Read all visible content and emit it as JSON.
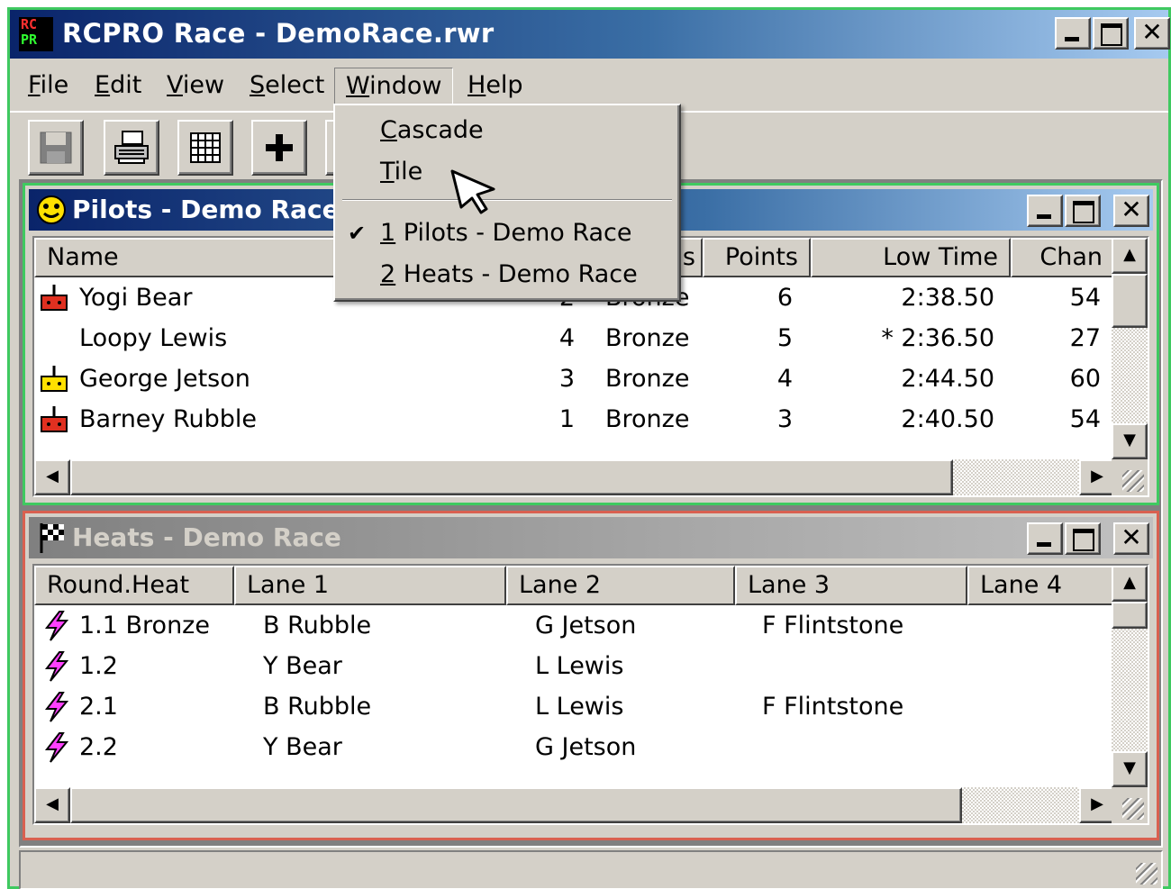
{
  "app": {
    "title": "RCPRO Race - DemoRace.rwr",
    "icon_text_top": "RC",
    "icon_text_bottom": "PR",
    "frame_color": "#3fc960"
  },
  "menubar": {
    "items": [
      {
        "key": "F",
        "rest": "ile"
      },
      {
        "key": "E",
        "rest": "dit"
      },
      {
        "key": "V",
        "rest": "iew"
      },
      {
        "key": "S",
        "rest": "elect"
      },
      {
        "key": "W",
        "rest": "indow"
      },
      {
        "key": "H",
        "rest": "elp"
      }
    ]
  },
  "toolbar": {
    "buttons": [
      "save-icon",
      "print-icon",
      "grid-icon",
      "add-icon"
    ]
  },
  "window_menu": {
    "cascade": {
      "key": "C",
      "rest": "ascade"
    },
    "tile": {
      "key": "T",
      "rest": "ile"
    },
    "windows": [
      {
        "key": "1",
        "rest": " Pilots - Demo Race",
        "checked": true
      },
      {
        "key": "2",
        "rest": " Heats - Demo Race",
        "checked": false
      }
    ]
  },
  "pilots_window": {
    "title": "Pilots - Demo Race",
    "border_color": "#3fc960",
    "columns": [
      "Name",
      "",
      "",
      "Points",
      "Low Time",
      "Chan"
    ],
    "hidden_header_fragment": "s",
    "rows": [
      {
        "name": "Yogi Bear",
        "num": "2",
        "class": "Bronze",
        "points": "6",
        "low_time": "2:38.50",
        "chan": "54",
        "icon": "red-transmitter-icon"
      },
      {
        "name": "Loopy Lewis",
        "num": "4",
        "class": "Bronze",
        "points": "5",
        "low_time": "* 2:36.50",
        "chan": "27",
        "icon": ""
      },
      {
        "name": "George Jetson",
        "num": "3",
        "class": "Bronze",
        "points": "4",
        "low_time": "2:44.50",
        "chan": "60",
        "icon": "yellow-transmitter-icon"
      },
      {
        "name": "Barney Rubble",
        "num": "1",
        "class": "Bronze",
        "points": "3",
        "low_time": "2:40.50",
        "chan": "54",
        "icon": "red-transmitter-icon"
      }
    ]
  },
  "heats_window": {
    "title": "Heats - Demo Race",
    "border_color": "#d96050",
    "columns": [
      "Round.Heat",
      "Lane 1",
      "Lane 2",
      "Lane 3",
      "Lane 4"
    ],
    "rows": [
      {
        "heat": "1.1 Bronze",
        "lane1": "B Rubble",
        "lane2": "G Jetson",
        "lane3": "F Flintstone",
        "lane4": ""
      },
      {
        "heat": "1.2",
        "lane1": "Y Bear",
        "lane2": "L Lewis",
        "lane3": "",
        "lane4": ""
      },
      {
        "heat": "2.1",
        "lane1": "B Rubble",
        "lane2": "L Lewis",
        "lane3": "F Flintstone",
        "lane4": ""
      },
      {
        "heat": "2.2",
        "lane1": "Y Bear",
        "lane2": "G Jetson",
        "lane3": "",
        "lane4": ""
      }
    ]
  }
}
